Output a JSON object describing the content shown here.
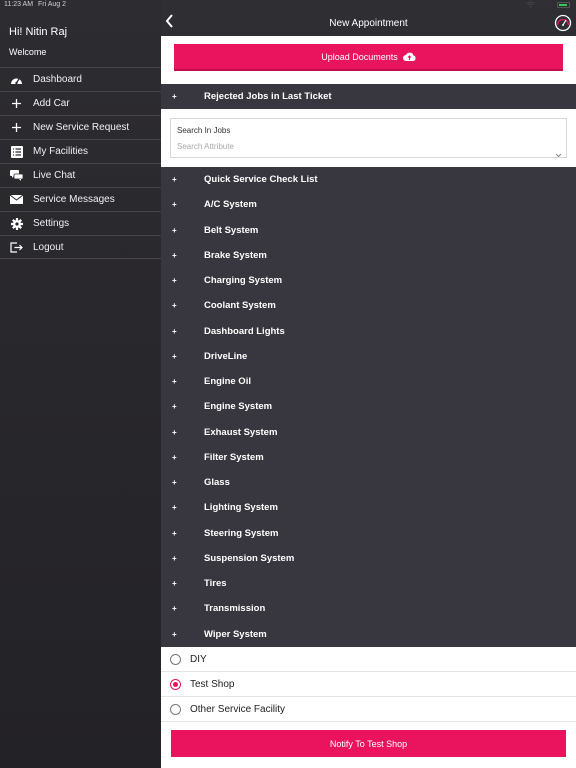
{
  "status_bar": {
    "time": "11:23 AM",
    "date": "Fri Aug 2",
    "battery": "85%"
  },
  "sidebar": {
    "greeting": "Hi! Nitin Raj",
    "welcome": "Welcome",
    "items": [
      {
        "label": "Dashboard",
        "icon": "dashboard-icon"
      },
      {
        "label": "Add Car",
        "icon": "plus-icon"
      },
      {
        "label": "New Service Request",
        "icon": "plus-icon"
      },
      {
        "label": "My Facilities",
        "icon": "list-icon"
      },
      {
        "label": "Live Chat",
        "icon": "chat-icon"
      },
      {
        "label": "Service Messages",
        "icon": "envelope-icon"
      },
      {
        "label": "Settings",
        "icon": "gear-icon"
      },
      {
        "label": "Logout",
        "icon": "logout-icon"
      }
    ]
  },
  "navbar": {
    "title": "New Appointment"
  },
  "upload": {
    "label": "Upload Documents"
  },
  "rejected": {
    "plus": "+",
    "label": "Rejected Jobs in Last Ticket"
  },
  "search": {
    "label": "Search In Jobs",
    "placeholder": "Search Attribute"
  },
  "jobs": [
    "Quick Service Check List",
    "A/C System",
    "Belt System",
    "Brake System",
    "Charging System",
    "Coolant System",
    "Dashboard Lights",
    "DriveLine",
    "Engine Oil",
    "Engine System",
    "Exhaust System",
    "Filter System",
    "Glass",
    "Lighting System",
    "Steering System",
    "Suspension System",
    "Tires",
    "Transmission",
    "Wiper System"
  ],
  "job_plus": "+",
  "service_options": [
    {
      "label": "DIY",
      "selected": false
    },
    {
      "label": "Test Shop",
      "selected": true
    },
    {
      "label": "Other Service Facility",
      "selected": false
    }
  ],
  "notify": {
    "label": "Notify To Test Shop"
  },
  "colors": {
    "accent": "#e9145d",
    "dark": "#38373f",
    "sidebar": "#2d2c31"
  }
}
